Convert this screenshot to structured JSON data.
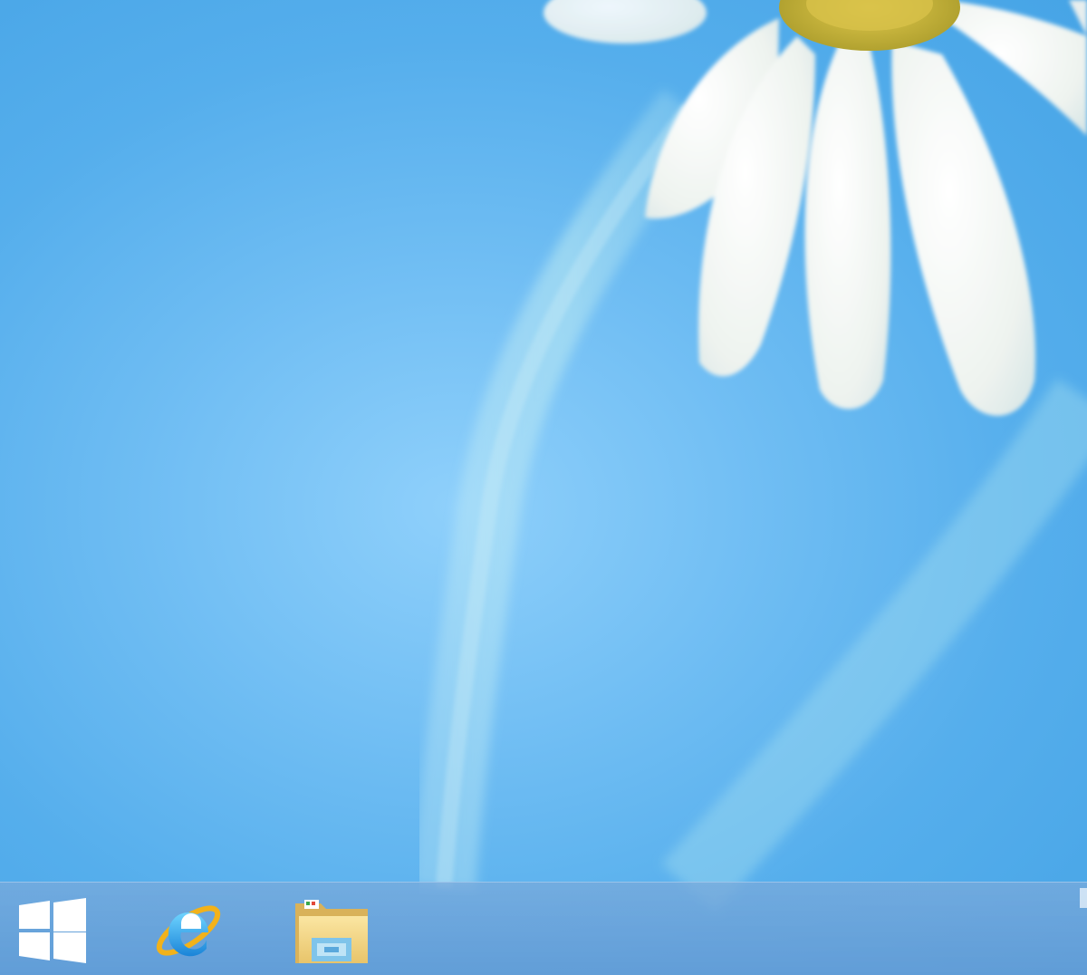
{
  "desktop": {
    "wallpaper": "daisy-over-blue",
    "colors": {
      "sky": "#6fbdf3",
      "petal": "#f2f5f2",
      "flower_center": "#c9b23a",
      "stem": "#9fd9f0"
    }
  },
  "taskbar": {
    "background_color": "#6e9fd6",
    "items": [
      {
        "name": "start-button",
        "icon": "windows-logo-icon"
      },
      {
        "name": "internet-explorer",
        "icon": "internet-explorer-icon"
      },
      {
        "name": "file-explorer",
        "icon": "folder-icon"
      }
    ]
  }
}
